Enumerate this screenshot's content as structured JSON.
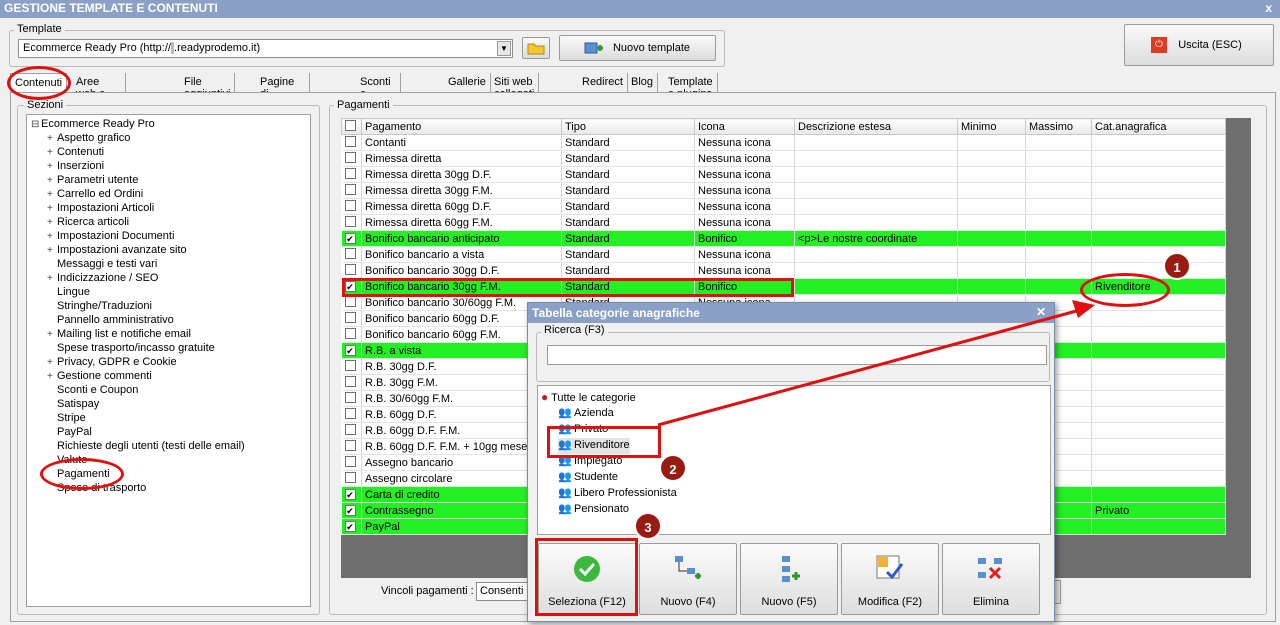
{
  "window": {
    "title": "GESTIONE TEMPLATE E CONTENUTI",
    "close": "x"
  },
  "template": {
    "label": "Template",
    "combo_value": "Ecommerce Ready Pro (http://",
    "combo_value_masked": "     ",
    "combo_value_end": ".readyprodemo.it)",
    "new_label": "Nuovo template"
  },
  "exit_label": "Uscita (ESC)",
  "tabs": [
    "Contenuti",
    "Aree web e categorie",
    "File aggiuntivi",
    "Pagine di contenuti",
    "Sconti e coupon",
    "Gallerie",
    "Siti web collegati",
    "Redirect",
    "Blog",
    "Template e plugins"
  ],
  "sections": {
    "label": "Sezioni",
    "root": "Ecommerce Ready Pro",
    "items": [
      {
        "label": "Aspetto grafico",
        "exp": true
      },
      {
        "label": "Contenuti",
        "exp": true
      },
      {
        "label": "Inserzioni",
        "exp": true
      },
      {
        "label": "Parametri utente",
        "exp": true
      },
      {
        "label": "Carrello ed Ordini",
        "exp": true
      },
      {
        "label": "Impostazioni Articoli",
        "exp": true
      },
      {
        "label": "Ricerca articoli",
        "exp": true
      },
      {
        "label": "Impostazioni Documenti",
        "exp": true
      },
      {
        "label": "Impostazioni avanzate sito",
        "exp": true
      },
      {
        "label": "Messaggi e testi vari",
        "exp": false
      },
      {
        "label": "Indicizzazione / SEO",
        "exp": true
      },
      {
        "label": "Lingue",
        "exp": false
      },
      {
        "label": "Stringhe/Traduzioni",
        "exp": false
      },
      {
        "label": "Pannello amministrativo",
        "exp": false
      },
      {
        "label": "Mailing list e notifiche email",
        "exp": true
      },
      {
        "label": "Spese trasporto/incasso gratuite",
        "exp": false
      },
      {
        "label": "Privacy, GDPR e Cookie",
        "exp": true
      },
      {
        "label": "Gestione commenti",
        "exp": true
      },
      {
        "label": "Sconti e Coupon",
        "exp": false
      },
      {
        "label": "Satispay",
        "exp": false
      },
      {
        "label": "Stripe",
        "exp": false
      },
      {
        "label": "PayPal",
        "exp": false
      },
      {
        "label": "Richieste degli utenti (testi delle email)",
        "exp": false
      },
      {
        "label": "Valute",
        "exp": false
      },
      {
        "label": "Pagamenti",
        "exp": false
      },
      {
        "label": "Spese di trasporto",
        "exp": false
      }
    ]
  },
  "payments": {
    "label": "Pagamenti",
    "columns": [
      "Pagamento",
      "Tipo",
      "Icona",
      "Descrizione estesa",
      "Minimo",
      "Massimo",
      "Cat.anagrafica"
    ],
    "rows": [
      {
        "c": false,
        "g": false,
        "name": "Contanti",
        "tipo": "Standard",
        "icona": "Nessuna icona",
        "desc": "",
        "cat": ""
      },
      {
        "c": false,
        "g": false,
        "name": "Rimessa diretta",
        "tipo": "Standard",
        "icona": "Nessuna icona",
        "desc": "",
        "cat": ""
      },
      {
        "c": false,
        "g": false,
        "name": "Rimessa diretta 30gg D.F.",
        "tipo": "Standard",
        "icona": "Nessuna icona",
        "desc": "",
        "cat": ""
      },
      {
        "c": false,
        "g": false,
        "name": "Rimessa diretta 30gg F.M.",
        "tipo": "Standard",
        "icona": "Nessuna icona",
        "desc": "",
        "cat": ""
      },
      {
        "c": false,
        "g": false,
        "name": "Rimessa diretta 60gg D.F.",
        "tipo": "Standard",
        "icona": "Nessuna icona",
        "desc": "",
        "cat": ""
      },
      {
        "c": false,
        "g": false,
        "name": "Rimessa diretta 60gg F.M.",
        "tipo": "Standard",
        "icona": "Nessuna icona",
        "desc": "",
        "cat": ""
      },
      {
        "c": true,
        "g": true,
        "name": "Bonifico bancario anticipato",
        "tipo": "Standard",
        "icona": "Bonifico",
        "desc": "<p>Le nostre coordinate",
        "cat": ""
      },
      {
        "c": false,
        "g": false,
        "name": "Bonifico bancario a vista",
        "tipo": "Standard",
        "icona": "Nessuna icona",
        "desc": "",
        "cat": ""
      },
      {
        "c": false,
        "g": false,
        "name": "Bonifico bancario 30gg D.F.",
        "tipo": "Standard",
        "icona": "Nessuna icona",
        "desc": "",
        "cat": ""
      },
      {
        "c": true,
        "g": true,
        "name": "Bonifico bancario 30gg F.M.",
        "tipo": "Standard",
        "icona": "Bonifico",
        "desc": "",
        "cat": "Rivenditore"
      },
      {
        "c": false,
        "g": false,
        "name": "Bonifico bancario 30/60gg F.M.",
        "tipo": "Standard",
        "icona": "Nessuna icona",
        "desc": "",
        "cat": ""
      },
      {
        "c": false,
        "g": false,
        "name": "Bonifico bancario 60gg D.F.",
        "tipo": "",
        "icona": "",
        "desc": "",
        "cat": ""
      },
      {
        "c": false,
        "g": false,
        "name": "Bonifico bancario 60gg F.M.",
        "tipo": "",
        "icona": "",
        "desc": "",
        "cat": ""
      },
      {
        "c": true,
        "g": true,
        "name": "R.B. a vista",
        "tipo": "",
        "icona": "",
        "desc": "",
        "cat": ""
      },
      {
        "c": false,
        "g": false,
        "name": "R.B. 30gg D.F.",
        "tipo": "",
        "icona": "",
        "desc": "",
        "cat": ""
      },
      {
        "c": false,
        "g": false,
        "name": "R.B. 30gg F.M.",
        "tipo": "",
        "icona": "",
        "desc": "",
        "cat": ""
      },
      {
        "c": false,
        "g": false,
        "name": "R.B. 30/60gg F.M.",
        "tipo": "",
        "icona": "",
        "desc": "",
        "cat": ""
      },
      {
        "c": false,
        "g": false,
        "name": "R.B. 60gg D.F.",
        "tipo": "",
        "icona": "",
        "desc": "",
        "cat": ""
      },
      {
        "c": false,
        "g": false,
        "name": "R.B. 60gg D.F. F.M.",
        "tipo": "",
        "icona": "",
        "desc": "",
        "cat": ""
      },
      {
        "c": false,
        "g": false,
        "name": "R.B. 60gg D.F. F.M. + 10gg mese",
        "tipo": "",
        "icona": "",
        "desc": "",
        "cat": ""
      },
      {
        "c": false,
        "g": false,
        "name": "Assegno bancario",
        "tipo": "",
        "icona": "",
        "desc": "",
        "cat": ""
      },
      {
        "c": false,
        "g": false,
        "name": "Assegno circolare",
        "tipo": "",
        "icona": "",
        "desc": "",
        "cat": ""
      },
      {
        "c": true,
        "g": true,
        "name": "Carta di credito",
        "tipo": "",
        "icona": "",
        "desc": "",
        "cat": ""
      },
      {
        "c": true,
        "g": true,
        "name": "Contrassegno",
        "tipo": "",
        "icona": "",
        "desc": "",
        "cat": "Privato"
      },
      {
        "c": true,
        "g": true,
        "name": "PayPal",
        "tipo": "",
        "icona": "",
        "desc": "",
        "cat": ""
      }
    ],
    "constraints_label": "Vincoli pagamenti :",
    "constraints_value": "Consenti d"
  },
  "dialog": {
    "title": "Tabella categorie anagrafiche",
    "search_label": "Ricerca (F3)",
    "search_value": "",
    "root": "Tutte le categorie",
    "categories": [
      "Azienda",
      "Privato",
      "Rivenditore",
      "Impiegato",
      "Studente",
      "Libero Professionista",
      "Pensionato"
    ],
    "buttons": [
      {
        "label": "Seleziona (F12)",
        "icon": "check-icon"
      },
      {
        "label": "Nuovo (F4)",
        "icon": "tree-add-icon"
      },
      {
        "label": "Nuovo (F5)",
        "icon": "tree-add-child-icon"
      },
      {
        "label": "Modifica (F2)",
        "icon": "grid-edit-icon"
      },
      {
        "label": "Elimina",
        "icon": "tree-delete-icon"
      }
    ]
  },
  "badges": [
    "1",
    "2",
    "3"
  ],
  "colors": {
    "highlight": "#23f023",
    "annotation": "#e01010",
    "badge": "#9a1b12",
    "titlebar": "#8aa0c6"
  }
}
